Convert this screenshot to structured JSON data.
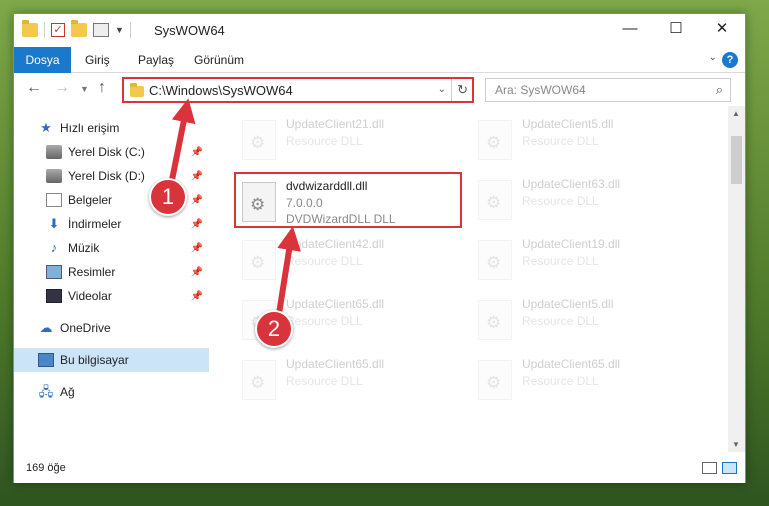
{
  "window": {
    "title": "SysWOW64",
    "controls": {
      "minimize": "—",
      "maximize": "☐",
      "close": "✕"
    }
  },
  "ribbon": {
    "tabs": [
      {
        "label": "Dosya",
        "active": true
      },
      {
        "label": "Giriş"
      },
      {
        "label": "Paylaş"
      },
      {
        "label": "Görünüm"
      }
    ],
    "help": "?"
  },
  "nav": {
    "address": "C:\\Windows\\SysWOW64",
    "search_placeholder": "Ara: SysWOW64"
  },
  "sidebar": {
    "items": [
      {
        "label": "Hızlı erişim",
        "icon": "star-icon"
      },
      {
        "label": "Yerel Disk (C:)",
        "icon": "disk-icon",
        "pinned": true
      },
      {
        "label": "Yerel Disk (D:)",
        "icon": "disk-icon",
        "pinned": true
      },
      {
        "label": "Belgeler",
        "icon": "documents-icon",
        "pinned": true
      },
      {
        "label": "İndirmeler",
        "icon": "download-icon",
        "pinned": true
      },
      {
        "label": "Müzik",
        "icon": "music-icon",
        "pinned": true
      },
      {
        "label": "Resimler",
        "icon": "pictures-icon",
        "pinned": true
      },
      {
        "label": "Videolar",
        "icon": "videos-icon",
        "pinned": true
      },
      {
        "label": "OneDrive",
        "icon": "cloud-icon"
      },
      {
        "label": "Bu bilgisayar",
        "icon": "computer-icon",
        "selected": true
      },
      {
        "label": "Ağ",
        "icon": "network-icon"
      }
    ]
  },
  "files": [
    {
      "name": "UpdateClient21.dll",
      "sub1": "Resource DLL",
      "sub2": ""
    },
    {
      "name": "UpdateClient5.dll",
      "sub1": "Resource DLL",
      "sub2": ""
    },
    {
      "name": "dvdwizarddll.dll",
      "sub1": "7.0.0.0",
      "sub2": "DVDWizardDLL DLL"
    },
    {
      "name": "UpdateClient63.dll",
      "sub1": "Resource DLL",
      "sub2": ""
    },
    {
      "name": "UpdateClient42.dll",
      "sub1": "Resource DLL",
      "sub2": ""
    },
    {
      "name": "UpdateClient19.dll",
      "sub1": "Resource DLL",
      "sub2": ""
    },
    {
      "name": "UpdateClient65.dll",
      "sub1": "Resource DLL",
      "sub2": ""
    },
    {
      "name": "UpdateClient5.dll",
      "sub1": "Resource DLL",
      "sub2": ""
    },
    {
      "name": "UpdateClient65.dll",
      "sub1": "Resource DLL",
      "sub2": ""
    },
    {
      "name": "UpdateClient65.dll",
      "sub1": "Resource DLL",
      "sub2": ""
    }
  ],
  "status": {
    "count": "169 öğe"
  },
  "annotations": {
    "step1": "1",
    "step2": "2"
  }
}
